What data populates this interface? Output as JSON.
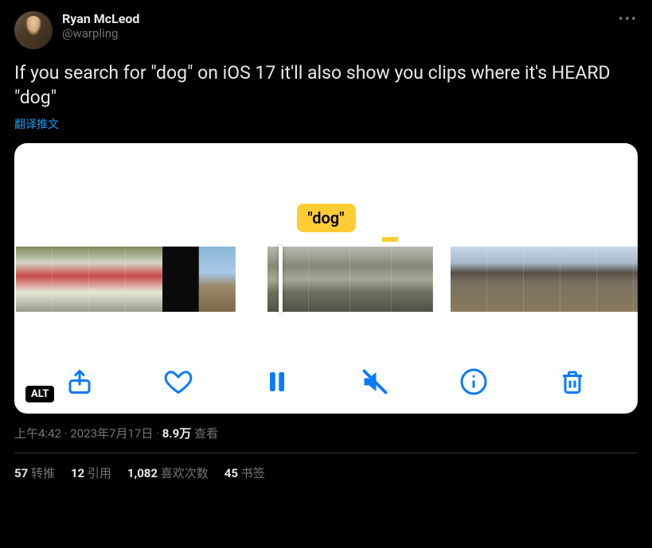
{
  "user": {
    "display_name": "Ryan McLeod",
    "handle": "@warpling"
  },
  "tweet_text": "If you search for \"dog\" on iOS 17 it'll also show you clips where it's HEARD \"dog\"",
  "translate_label": "翻译推文",
  "media": {
    "tag_label": "\"dog\"",
    "alt_badge": "ALT",
    "icons": {
      "share": "share-icon",
      "heart": "heart-icon",
      "pause": "pause-icon",
      "mute": "speaker-muted-icon",
      "info": "info-icon",
      "trash": "trash-icon"
    }
  },
  "meta": {
    "time": "上午4:42",
    "separator1": " · ",
    "date": "2023年7月17日",
    "separator2": " · ",
    "views_count": "8.9万",
    "views_label": " 查看"
  },
  "stats": {
    "retweets_count": "57",
    "retweets_label": " 转推",
    "quotes_count": "12",
    "quotes_label": " 引用",
    "likes_count": "1,082",
    "likes_label": " 喜欢次数",
    "bookmarks_count": "45",
    "bookmarks_label": " 书签"
  }
}
